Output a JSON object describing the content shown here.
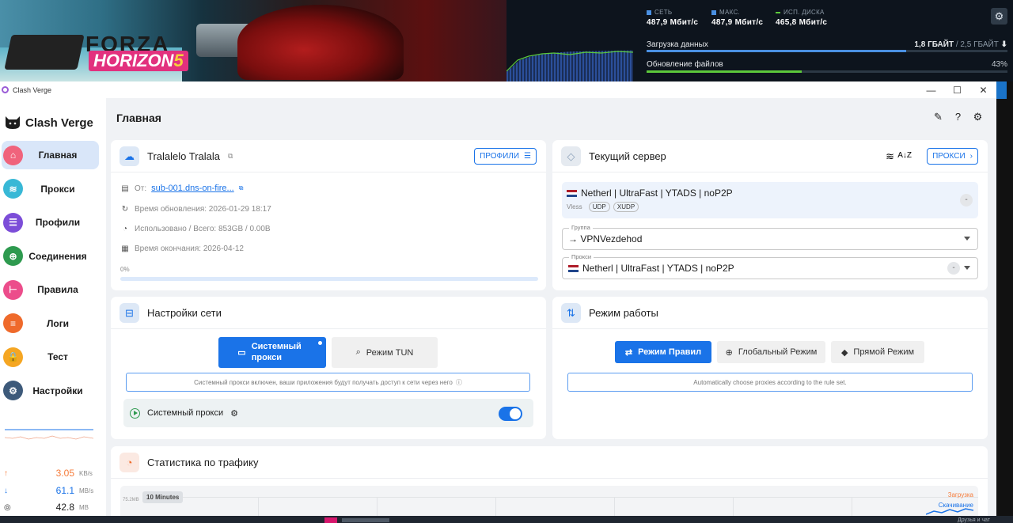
{
  "steam": {
    "game_logo_top": "FORZA",
    "game_logo_bottom": "HORIZON",
    "game_logo_num": "5",
    "stats": [
      {
        "label": "СЕТЬ",
        "value": "487,9 Мбит/с",
        "color": "#4a90e2"
      },
      {
        "label": "МАКС.",
        "value": "487,9 Мбит/с",
        "color": "#4a90e2"
      },
      {
        "label": "ИСП. ДИСКА",
        "value": "465,8 Мбит/с",
        "color": "#5cc93b"
      }
    ],
    "download_label": "Загрузка данных",
    "download_done": "1,8 ГБАЙТ",
    "download_total": " / 2,5 ГБАЙТ",
    "download_progress": 0.72,
    "update_label": "Обновление файлов",
    "update_percent": "43%",
    "update_progress": 0.43,
    "taskbar_right": "Друзья и чат"
  },
  "window": {
    "title": "Clash Verge",
    "minimize": "—",
    "maximize": "☐",
    "close": "✕"
  },
  "sidebar": {
    "brand": "Clash Verge",
    "items": [
      {
        "label": "Главная",
        "icon": "home-icon",
        "color": "#f0637c",
        "glyph": "⌂",
        "active": true
      },
      {
        "label": "Прокси",
        "icon": "wifi-icon",
        "color": "#38b8d6",
        "glyph": "≋",
        "active": false
      },
      {
        "label": "Профили",
        "icon": "profiles-icon",
        "color": "#7c4dd8",
        "glyph": "☰",
        "active": false
      },
      {
        "label": "Соединения",
        "icon": "globe-icon",
        "color": "#2e9a4f",
        "glyph": "⊕",
        "active": false
      },
      {
        "label": "Правила",
        "icon": "rules-icon",
        "color": "#ec4d8b",
        "glyph": "⊢",
        "active": false
      },
      {
        "label": "Логи",
        "icon": "logs-icon",
        "color": "#ef6a2b",
        "glyph": "≡",
        "active": false
      },
      {
        "label": "Тест",
        "icon": "lock-icon",
        "color": "#f5a623",
        "glyph": "🔒",
        "active": false
      },
      {
        "label": "Настройки",
        "icon": "settings-icon",
        "color": "#3d5a7a",
        "glyph": "⚙",
        "active": false
      }
    ],
    "upload": {
      "value": "3.05",
      "unit": "KB/s",
      "arrow": "↑"
    },
    "download": {
      "value": "61.1",
      "unit": "MB/s",
      "arrow": "↓"
    },
    "memory": {
      "value": "42.8",
      "unit": "MB",
      "arrow": "◎"
    }
  },
  "main": {
    "title": "Главная",
    "profile_card": {
      "title": "Tralalelo Tralala",
      "button": "ПРОФИЛИ",
      "from_label": "От:",
      "from_link": "sub-001.dns-on-fire...",
      "updated": "Время обновления: 2026-01-29 18:17",
      "usage": "Использовано / Всего: 853GB / 0.00B",
      "expire": "Время окончания: 2026-04-12",
      "percent": "0%",
      "progress": 0
    },
    "server_card": {
      "title": "Текущий сервер",
      "button": "ПРОКСИ",
      "server_name": "Netherl | UltraFast | YTADS | noP2P",
      "protocol": "Vless",
      "tags": [
        "UDP",
        "XUDP"
      ],
      "group_legend": "Группа",
      "group_value": "→ VPNVezdehod",
      "proxy_legend": "Прокси",
      "proxy_value": "Netherl | UltraFast | YTADS | noP2P",
      "latency": "-"
    },
    "network_card": {
      "title": "Настройки сети",
      "btn_system": "Системный прокси",
      "btn_tun": "Режим TUN",
      "description": "Системный прокси включен, ваши приложения будут получать доступ к сети через него",
      "row_label": "Системный прокси",
      "enabled": true
    },
    "mode_card": {
      "title": "Режим работы",
      "btn_rule": "Режим Правил",
      "btn_global": "Глобальный Режим",
      "btn_direct": "Прямой Режим",
      "description": "Automatically choose proxies according to the rule set."
    },
    "traffic_card": {
      "title": "Статистика по трафику",
      "range": "10 Minutes",
      "y_tick": "75.2MB",
      "legend_upload": "Загрузка",
      "legend_download": "Скачивание"
    }
  }
}
